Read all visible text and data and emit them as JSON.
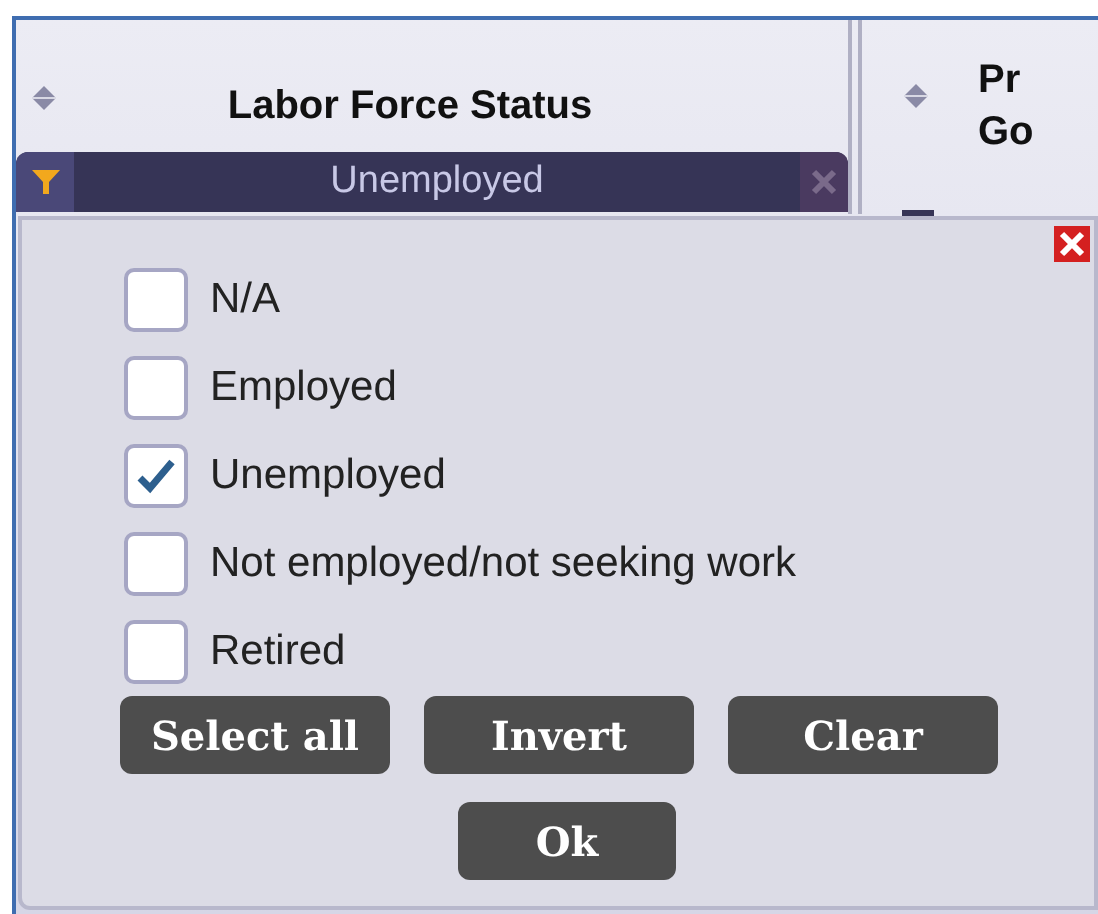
{
  "columns": [
    {
      "title_lines": [
        "Labor Force Status"
      ],
      "filter": {
        "value": "Unemployed"
      }
    },
    {
      "title_lines": [
        "Pr",
        "Go"
      ]
    }
  ],
  "filter_popup": {
    "options": [
      {
        "label": "N/A",
        "checked": false
      },
      {
        "label": "Employed",
        "checked": false
      },
      {
        "label": "Unemployed",
        "checked": true
      },
      {
        "label": "Not employed/not seeking work",
        "checked": false
      },
      {
        "label": "Retired",
        "checked": false
      }
    ],
    "buttons": [
      "Select all",
      "Invert",
      "Clear"
    ],
    "ok_button": "Ok"
  }
}
